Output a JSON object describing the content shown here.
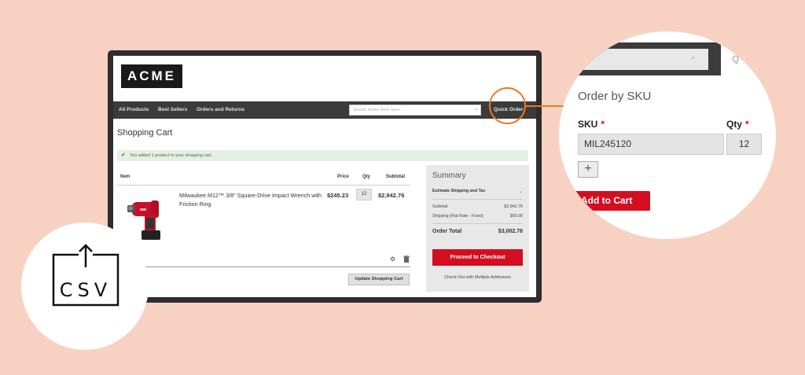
{
  "store": {
    "logo": "ACME",
    "nav": [
      "All Products",
      "Best Sellers",
      "Orders and Returns"
    ],
    "search_placeholder": "Search entire store here...",
    "quick_order": "Quick Order"
  },
  "cart": {
    "title": "Shopping Cart",
    "alert": "You added 1 product to your shopping cart.",
    "headers": {
      "item": "Item",
      "price": "Price",
      "qty": "Qty",
      "subtotal": "Subtotal"
    },
    "item": {
      "name": "Milwaukee M12™ 3/8\" Square-Drive Impact Wrench with Friction Ring",
      "price": "$245.23",
      "qty": "12",
      "subtotal": "$2,942.76"
    },
    "update_button": "Update Shopping Cart"
  },
  "summary": {
    "title": "Summary",
    "estimate": "Estimate Shipping and Tax",
    "subtotal_label": "Subtotal",
    "subtotal_value": "$2,942.76",
    "shipping_label": "Shipping (Flat Rate - Fixed)",
    "shipping_value": "$60.00",
    "total_label": "Order Total",
    "total_value": "$3,002.76",
    "checkout_button": "Proceed to Checkout",
    "multi_address": "Check Out with Multiple Addresses"
  },
  "zoom": {
    "quick_order_partial": "Q",
    "title": "Order by SKU",
    "sku_label": "SKU",
    "qty_label": "Qty",
    "required_mark": "*",
    "sku_value": "MIL245120",
    "qty_value": "12",
    "add_button": "Add to Cart"
  },
  "csv": {
    "label": "CSV"
  },
  "colors": {
    "accent": "#d40e20",
    "highlight": "#ee7722",
    "background": "#f7d2c3"
  }
}
